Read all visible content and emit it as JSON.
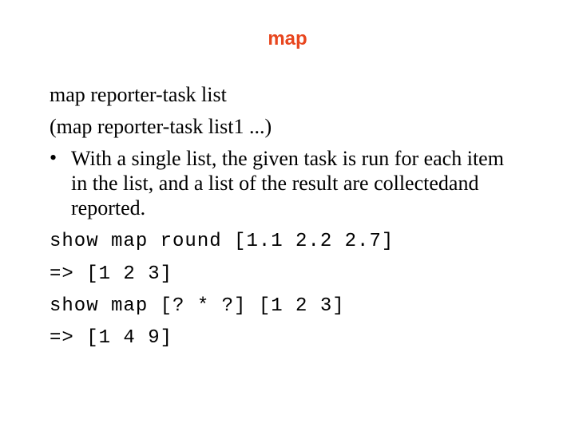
{
  "title": "map",
  "syntax": [
    "map reporter-task list",
    "(map reporter-task list1 ...)"
  ],
  "bullet": {
    "symbol": "•",
    "text": "With a single list, the given task is run for each item in the list, and a list of the result are collectedand reported."
  },
  "code": [
    "show map round [1.1 2.2 2.7]",
    "=> [1 2 3]",
    "show map [? * ?] [1 2 3]",
    "=> [1 4 9]"
  ]
}
